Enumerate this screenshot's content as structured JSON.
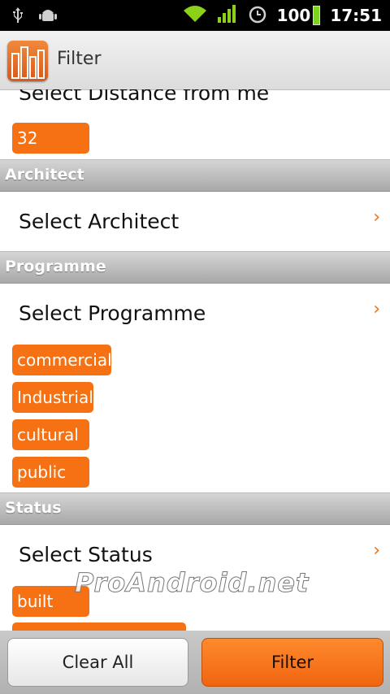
{
  "status_bar": {
    "left_icons": [
      "usb-icon",
      "android-debug-icon"
    ],
    "right_icons": [
      "wifi-icon",
      "signal-icon",
      "alarm-icon"
    ],
    "battery": "100",
    "time": "17:51"
  },
  "action_bar": {
    "title": "Filter",
    "logo_icon": "city-buildings-logo"
  },
  "content": {
    "distance": {
      "label": "Select Distance from me",
      "value": "32"
    },
    "architect": {
      "header": "Architect",
      "label": "Select Architect"
    },
    "programme": {
      "header": "Programme",
      "label": "Select Programme",
      "chips": [
        "commercial",
        "Industrial",
        "cultural",
        "public"
      ]
    },
    "status": {
      "header": "Status",
      "label": "Select Status",
      "chips": [
        "built"
      ]
    },
    "chevron": "›",
    "watermark": "ProAndroid.net"
  },
  "bottom": {
    "clear_label": "Clear All",
    "filter_label": "Filter"
  },
  "colors": {
    "accent": "#f57113",
    "header_gray": "#b5b5b5"
  }
}
